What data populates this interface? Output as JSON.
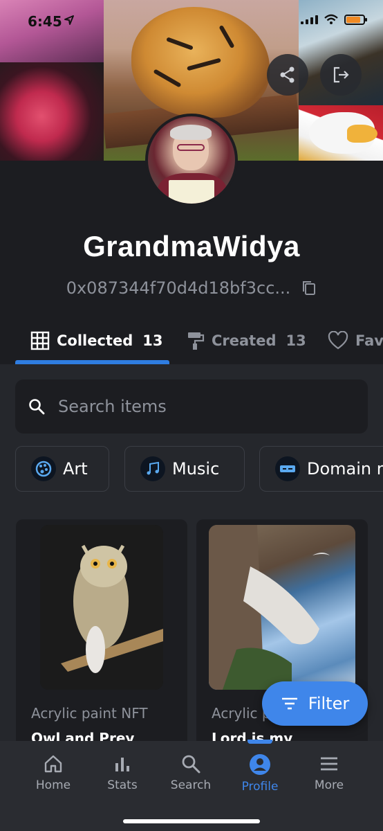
{
  "status_bar": {
    "time": "6:45",
    "battery_level": 0.85,
    "battery_color": "#f08a24"
  },
  "banner": {
    "share_icon": "share-icon",
    "logout_icon": "logout-icon"
  },
  "profile": {
    "username": "GrandmaWidya",
    "wallet_address": "0x087344f70d4d18bf3cc...",
    "copy_icon": "copy-icon"
  },
  "tabs": [
    {
      "label": "Collected",
      "count": "13",
      "icon": "grid-icon",
      "active": true
    },
    {
      "label": "Created",
      "count": "13",
      "icon": "paint-roller-icon",
      "active": false
    },
    {
      "label": "Fav",
      "count": "",
      "icon": "heart-icon",
      "active": false
    }
  ],
  "search": {
    "placeholder": "Search items"
  },
  "category_chips": [
    {
      "label": "Art",
      "icon": "art-icon"
    },
    {
      "label": "Music",
      "icon": "music-icon"
    },
    {
      "label": "Domain n",
      "icon": "domain-icon"
    }
  ],
  "items": [
    {
      "collection": "Acrylic paint NFT",
      "title": "Owl and Prey"
    },
    {
      "collection": "Acrylic p",
      "title": "Lord is my"
    }
  ],
  "filter": {
    "label": "Filter",
    "icon": "filter-icon"
  },
  "bottom_nav": [
    {
      "label": "Home",
      "icon": "home-icon"
    },
    {
      "label": "Stats",
      "icon": "stats-icon"
    },
    {
      "label": "Search",
      "icon": "search-icon"
    },
    {
      "label": "Profile",
      "icon": "profile-icon",
      "active": true
    },
    {
      "label": "More",
      "icon": "menu-icon"
    }
  ],
  "colors": {
    "background": "#1c1d21",
    "surface": "#25272c",
    "accent": "#3f86ea",
    "muted_text": "#8e929b"
  }
}
